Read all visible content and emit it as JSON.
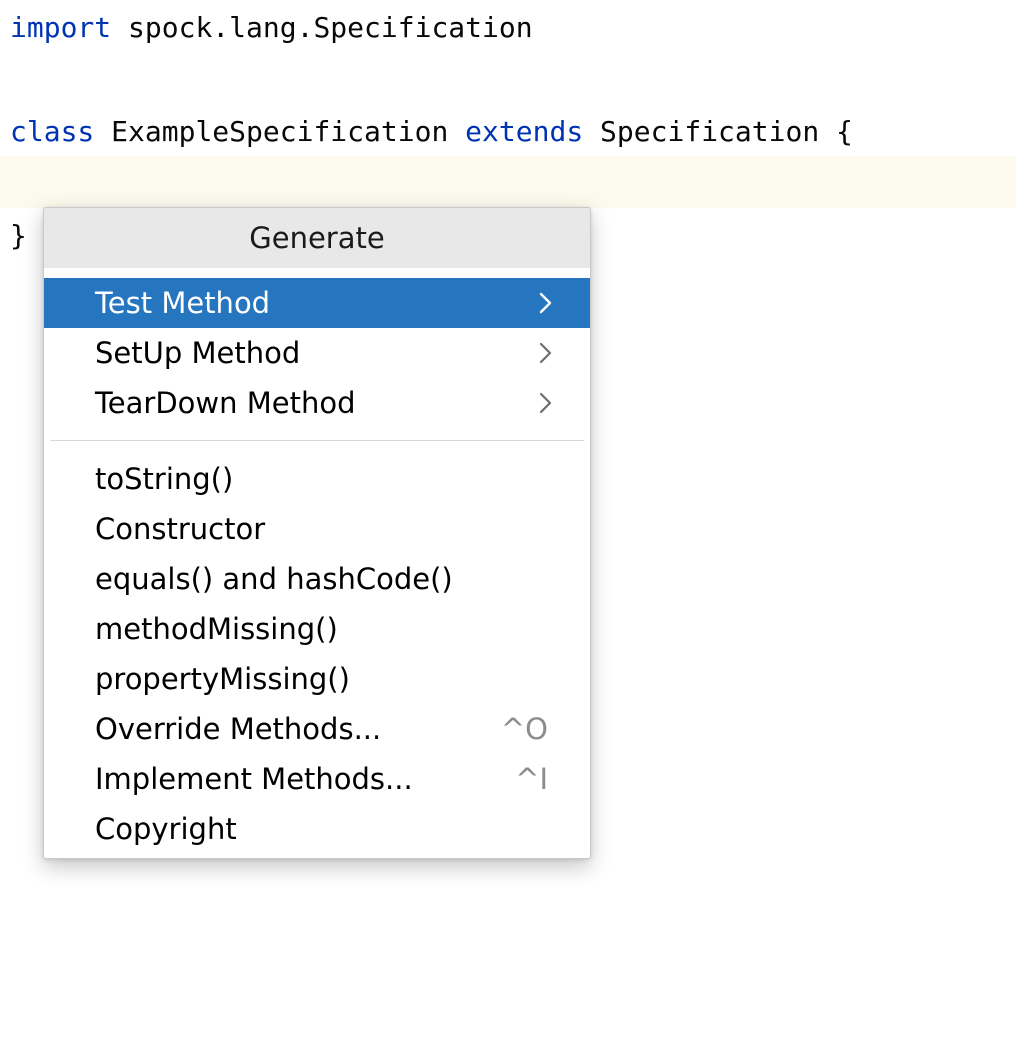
{
  "code": {
    "line1": {
      "keyword": "import",
      "rest": " spock.lang.Specification"
    },
    "line3": {
      "keyword1": "class",
      "name": " ExampleSpecification ",
      "keyword2": "extends",
      "rest": " Specification {"
    },
    "line5": "}"
  },
  "popup": {
    "title": "Generate",
    "submenu_items": [
      {
        "label": "Test Method",
        "icon": "chevron-right-icon",
        "selected": true
      },
      {
        "label": "SetUp Method",
        "icon": "chevron-right-icon",
        "selected": false
      },
      {
        "label": "TearDown Method",
        "icon": "chevron-right-icon",
        "selected": false
      }
    ],
    "items": [
      {
        "label": "toString()"
      },
      {
        "label": "Constructor"
      },
      {
        "label": "equals() and hashCode()"
      },
      {
        "label": "methodMissing()"
      },
      {
        "label": "propertyMissing()"
      },
      {
        "label": "Override Methods...",
        "shortcut": "^O"
      },
      {
        "label": "Implement Methods...",
        "shortcut": "^I"
      },
      {
        "label": "Copyright"
      }
    ]
  },
  "colors": {
    "keyword": "#0033b3",
    "selection": "#2675bf",
    "current_line": "#fcfaed",
    "popup_header": "#e8e8e8",
    "shortcut": "#8c8c8c"
  }
}
